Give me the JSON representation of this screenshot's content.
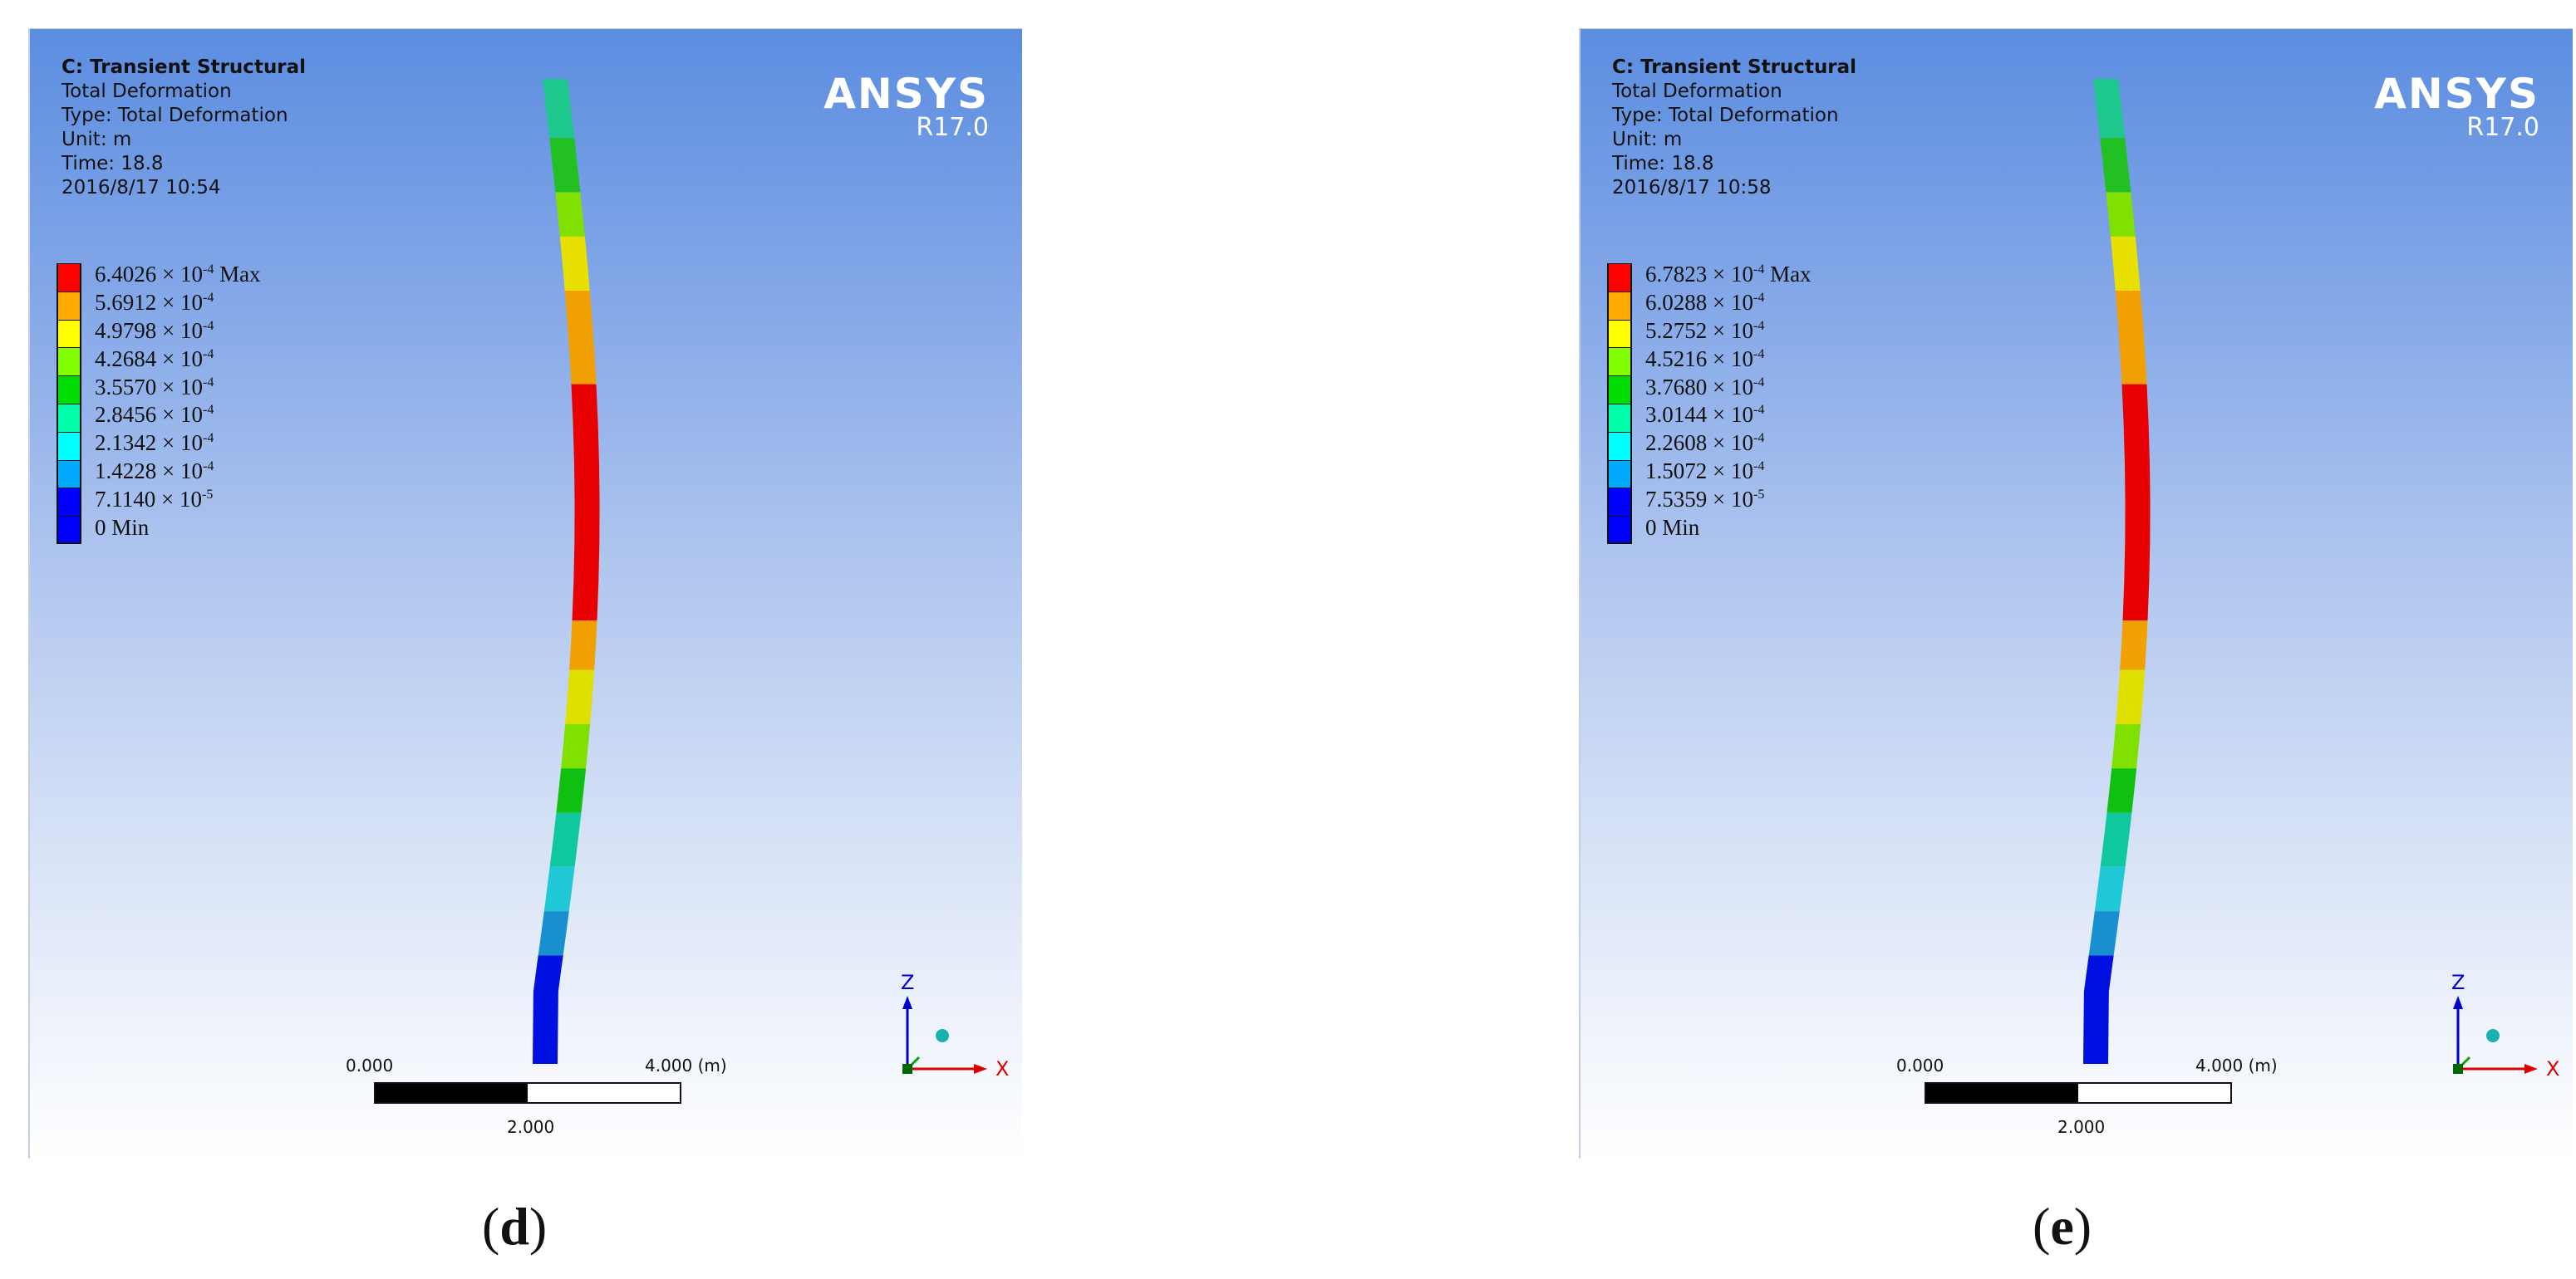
{
  "panels": [
    {
      "id": "d",
      "caption": "d",
      "header": {
        "title": "C: Transient Structural",
        "result": "Total Deformation",
        "type": "Type: Total Deformation",
        "unit": "Unit: m",
        "time": "Time: 18.8",
        "timestamp": "2016/8/17 10:54"
      },
      "legend": [
        {
          "mantissa": "6.4026 × 10",
          "exp": "-4",
          "suffix": " Max",
          "color": "#ff0000"
        },
        {
          "mantissa": "5.6912 × 10",
          "exp": "-4",
          "suffix": "",
          "color": "#ffaa00"
        },
        {
          "mantissa": "4.9798 × 10",
          "exp": "-4",
          "suffix": "",
          "color": "#ffff00"
        },
        {
          "mantissa": "4.2684 × 10",
          "exp": "-4",
          "suffix": "",
          "color": "#80ff00"
        },
        {
          "mantissa": "3.5570 × 10",
          "exp": "-4",
          "suffix": "",
          "color": "#00dd00"
        },
        {
          "mantissa": "2.8456 × 10",
          "exp": "-4",
          "suffix": "",
          "color": "#00ffaa"
        },
        {
          "mantissa": "2.1342 × 10",
          "exp": "-4",
          "suffix": "",
          "color": "#00ffff"
        },
        {
          "mantissa": "1.4228 × 10",
          "exp": "-4",
          "suffix": "",
          "color": "#00aaff"
        },
        {
          "mantissa": "7.1140 × 10",
          "exp": "-5",
          "suffix": "",
          "color": "#0000ff"
        },
        {
          "mantissa": "0 Min",
          "exp": "",
          "suffix": "",
          "color": "#0000ff"
        }
      ]
    },
    {
      "id": "e",
      "caption": "e",
      "header": {
        "title": "C: Transient Structural",
        "result": "Total Deformation",
        "type": "Type: Total Deformation",
        "unit": "Unit: m",
        "time": "Time: 18.8",
        "timestamp": "2016/8/17 10:58"
      },
      "legend": [
        {
          "mantissa": "6.7823 × 10",
          "exp": "-4",
          "suffix": " Max",
          "color": "#ff0000"
        },
        {
          "mantissa": "6.0288 × 10",
          "exp": "-4",
          "suffix": "",
          "color": "#ffaa00"
        },
        {
          "mantissa": "5.2752 × 10",
          "exp": "-4",
          "suffix": "",
          "color": "#ffff00"
        },
        {
          "mantissa": "4.5216 × 10",
          "exp": "-4",
          "suffix": "",
          "color": "#80ff00"
        },
        {
          "mantissa": "3.7680 × 10",
          "exp": "-4",
          "suffix": "",
          "color": "#00dd00"
        },
        {
          "mantissa": "3.0144 × 10",
          "exp": "-4",
          "suffix": "",
          "color": "#00ffaa"
        },
        {
          "mantissa": "2.2608 × 10",
          "exp": "-4",
          "suffix": "",
          "color": "#00ffff"
        },
        {
          "mantissa": "1.5072 × 10",
          "exp": "-4",
          "suffix": "",
          "color": "#00aaff"
        },
        {
          "mantissa": "7.5359 × 10",
          "exp": "-5",
          "suffix": "",
          "color": "#0000ff"
        },
        {
          "mantissa": "0 Min",
          "exp": "",
          "suffix": "",
          "color": "#0000ff"
        }
      ]
    }
  ],
  "logo": {
    "brand": "ANSYS",
    "version": "R17.0"
  },
  "scale_bar": {
    "left": "0.000",
    "right": "4.000 (m)",
    "middle": "2.000"
  },
  "triad": {
    "z": "Z",
    "x": "X"
  },
  "beam_colors_top_to_bottom": [
    "#1ec88c",
    "#22c022",
    "#80e000",
    "#e8e000",
    "#f0a000",
    "#e80000",
    "#f0a000",
    "#e0e000",
    "#80e000",
    "#10c010",
    "#10c8a0",
    "#20c8d8",
    "#1890d0",
    "#0010e0"
  ]
}
